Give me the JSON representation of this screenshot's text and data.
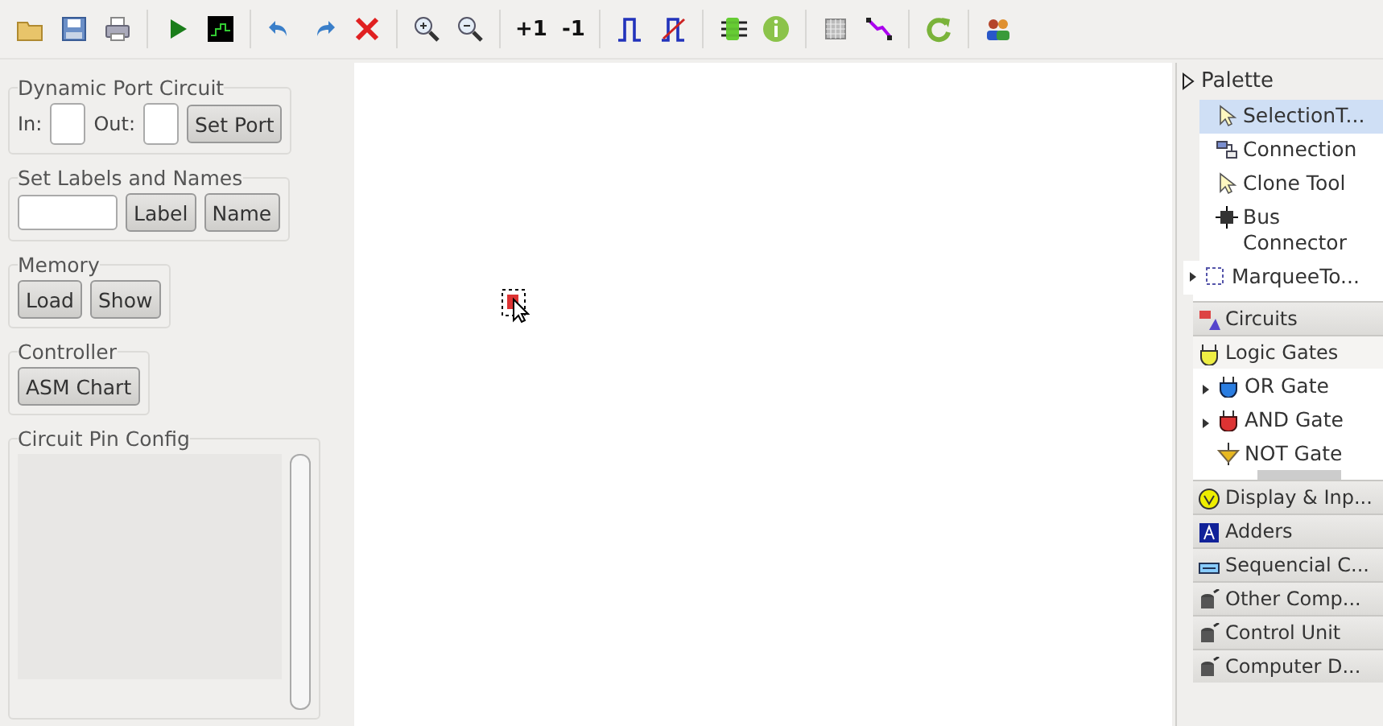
{
  "toolbar": {
    "text_buttons": [
      "+1",
      "-1"
    ]
  },
  "left_panel": {
    "groups": [
      {
        "title": "Dynamic Port Circuit",
        "kind": "ports",
        "labels": [
          "In:",
          "Out:"
        ],
        "buttons": [
          "Set Port"
        ]
      },
      {
        "title": "Set Labels and Names",
        "kind": "labels",
        "buttons": [
          "Label",
          "Name"
        ]
      },
      {
        "title": "Memory",
        "kind": "buttons",
        "buttons": [
          "Load",
          "Show"
        ]
      },
      {
        "title": "Controller",
        "kind": "buttons",
        "buttons": [
          "ASM Chart"
        ]
      },
      {
        "title": "Circuit Pin Config",
        "kind": "list"
      }
    ]
  },
  "palette": {
    "title": "Palette",
    "tools": [
      {
        "label": "SelectionT...",
        "selected": true,
        "expandable": false
      },
      {
        "label": "Connection",
        "selected": false,
        "expandable": false
      },
      {
        "label": "Clone Tool",
        "selected": false,
        "expandable": false
      },
      {
        "label": "Bus Connector",
        "selected": false,
        "expandable": false
      },
      {
        "label": "MarqueeTo...",
        "selected": false,
        "expandable": true
      }
    ],
    "drawers": [
      {
        "label": "Circuits",
        "expanded": false
      },
      {
        "label": "Logic Gates",
        "expanded": true,
        "items": [
          {
            "label": "OR Gate",
            "expandable": true
          },
          {
            "label": "AND Gate",
            "expandable": true
          },
          {
            "label": "NOT Gate",
            "expandable": false
          }
        ]
      },
      {
        "label": "Display & Inp...",
        "expanded": false
      },
      {
        "label": "Adders",
        "expanded": false
      },
      {
        "label": "Sequencial C...",
        "expanded": false
      },
      {
        "label": "Other Comp...",
        "expanded": false
      },
      {
        "label": "Control Unit",
        "expanded": false
      },
      {
        "label": "Computer D...",
        "expanded": false
      }
    ]
  }
}
